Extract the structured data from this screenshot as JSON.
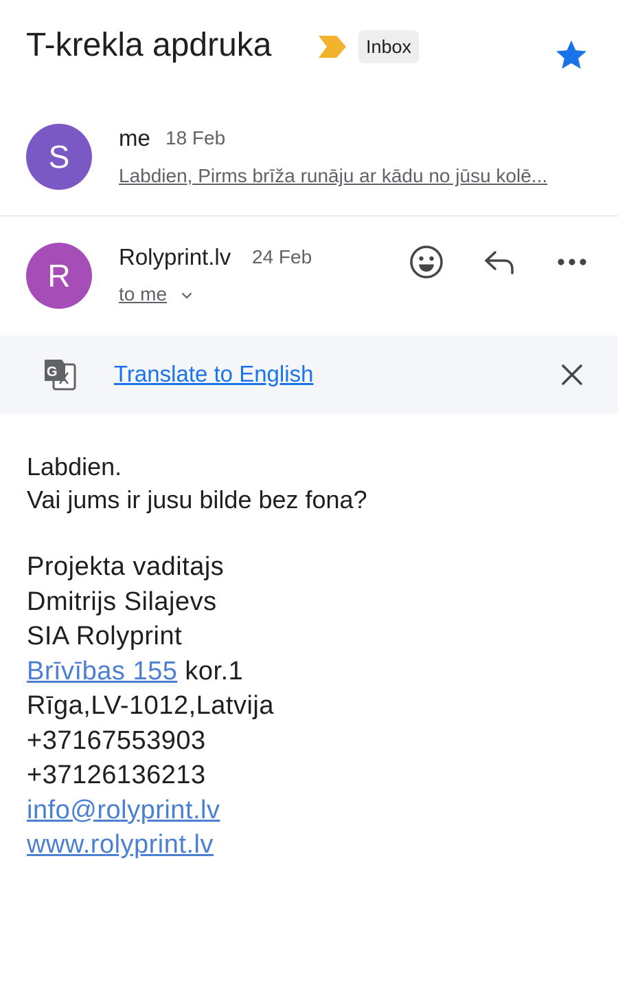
{
  "header": {
    "subject": "T-krekla apdruka",
    "label": "Inbox",
    "colors": {
      "importance": "#f2b22c",
      "star": "#1a73e8"
    }
  },
  "messages": [
    {
      "avatar_letter": "S",
      "avatar_color": "#7b59c5",
      "sender": "me",
      "date": "18 Feb",
      "snippet": "Labdien, Pirms brīža runāju ar kādu no jūsu kolē..."
    },
    {
      "avatar_letter": "R",
      "avatar_color": "#a64db8",
      "sender": "Rolyprint.lv",
      "date": "24 Feb",
      "recipient": "to me"
    }
  ],
  "translate": {
    "link_text": "Translate to English"
  },
  "email_body": {
    "greeting": "Labdien.",
    "question": "Vai jums ir jusu bilde bez fona?",
    "signature": {
      "role": "Projekta vaditajs",
      "name": "Dmitrijs Silajevs",
      "company": "SIA Rolyprint",
      "street_link": "Brīvības 155",
      "street_suffix": "kor.1",
      "city": "Rīga,LV-1012,Latvija",
      "phone1": "+37167553903",
      "phone2": "+37126136213",
      "email": "info@rolyprint.lv",
      "website": "www.rolyprint.lv"
    }
  }
}
